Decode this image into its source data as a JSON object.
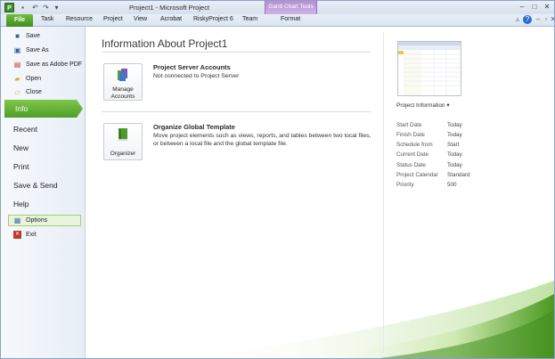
{
  "window": {
    "title": "Project1 - Microsoft Project",
    "contextual_group": "Gantt Chart Tools"
  },
  "ribbon": {
    "file_tab": "File",
    "tabs": [
      "Task",
      "Resource",
      "Project",
      "View",
      "Acrobat",
      "RiskyProject 6",
      "Team",
      "Format"
    ]
  },
  "backstage_nav": {
    "commands_top": [
      {
        "label": "Save",
        "icon": "save-icon"
      },
      {
        "label": "Save As",
        "icon": "save-as-icon"
      },
      {
        "label": "Save as Adobe PDF",
        "icon": "pdf-icon"
      },
      {
        "label": "Open",
        "icon": "open-folder-icon"
      },
      {
        "label": "Close",
        "icon": "close-folder-icon"
      }
    ],
    "tabs": [
      "Info",
      "Recent",
      "New",
      "Print",
      "Save & Send",
      "Help"
    ],
    "selected_tab": "Info",
    "commands_bottom": [
      {
        "label": "Options",
        "icon": "options-icon"
      },
      {
        "label": "Exit",
        "icon": "exit-icon"
      }
    ]
  },
  "info": {
    "title": "Information About Project1",
    "sections": [
      {
        "button_label": "Manage Accounts",
        "heading": "Project Server Accounts",
        "description": "Not connected to Project Server"
      },
      {
        "button_label": "Organizer",
        "heading": "Organize Global Template",
        "description": "Move project elements such as views, reports, and tables between two local files, or between a local file and the global template file."
      }
    ]
  },
  "project_info": {
    "heading": "Project Information",
    "dropdown_glyph": "▾",
    "rows": [
      {
        "label": "Start Date",
        "value": "Today"
      },
      {
        "label": "Finish Date",
        "value": "Today"
      },
      {
        "label": "Schedule from",
        "value": "Start"
      },
      {
        "label": "Current Date",
        "value": "Today"
      },
      {
        "label": "Status Date",
        "value": "Today"
      },
      {
        "label": "Project Calendar",
        "value": "Standard"
      },
      {
        "label": "Priority",
        "value": "500"
      }
    ]
  },
  "colors": {
    "accent_green": "#5aa92c",
    "contextual_purple": "#b690d6"
  }
}
